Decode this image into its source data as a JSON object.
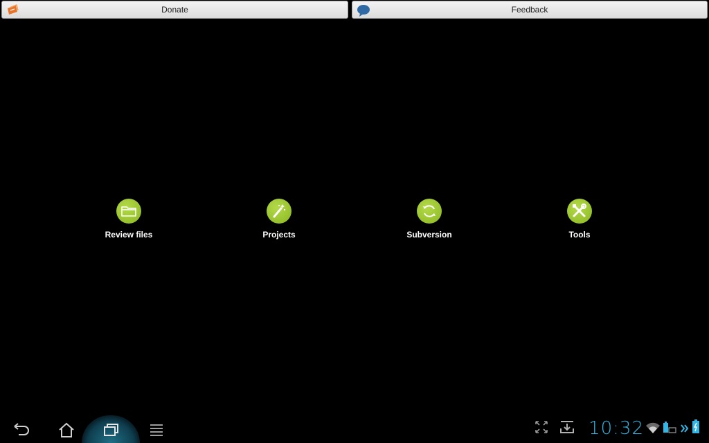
{
  "topbar": {
    "donate_label": "Donate",
    "feedback_label": "Feedback"
  },
  "tiles": [
    {
      "label": "Review files",
      "icon": "folder-icon"
    },
    {
      "label": "Projects",
      "icon": "magic-wand-icon"
    },
    {
      "label": "Subversion",
      "icon": "sync-icon"
    },
    {
      "label": "Tools",
      "icon": "tools-icon"
    }
  ],
  "status": {
    "clock": "10:32"
  },
  "colors": {
    "accent_green": "#8ab81f",
    "clock_blue": "#33b5e5",
    "donate_orange": "#e8732a",
    "feedback_blue": "#2f6aa5"
  }
}
